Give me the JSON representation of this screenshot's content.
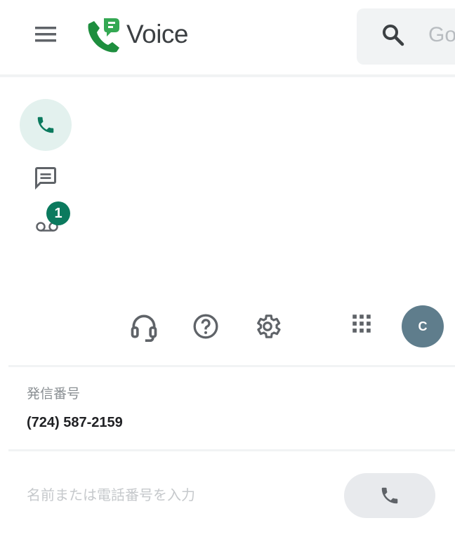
{
  "header": {
    "app_title": "Voice",
    "search_placeholder": "Go"
  },
  "rail": {
    "items": [
      {
        "name": "calls",
        "icon": "phone-icon",
        "active": true
      },
      {
        "name": "messages",
        "icon": "message-icon",
        "active": false
      },
      {
        "name": "voicemail",
        "icon": "voicemail-icon",
        "active": false,
        "badge": "1"
      }
    ]
  },
  "toolbar": {
    "icons": [
      "headset-icon",
      "help-icon",
      "settings-icon",
      "apps-grid-icon"
    ],
    "avatar_initial": "C"
  },
  "caller": {
    "label": "発信番号",
    "number": "(724) 587-2159"
  },
  "dialer": {
    "placeholder": "名前または電話番号を入力"
  },
  "colors": {
    "brand_green": "#1e8e3e",
    "accent_teal": "#0b7a5e",
    "active_bg": "#e3f1ee",
    "avatar_bg": "#5f7d8c"
  }
}
